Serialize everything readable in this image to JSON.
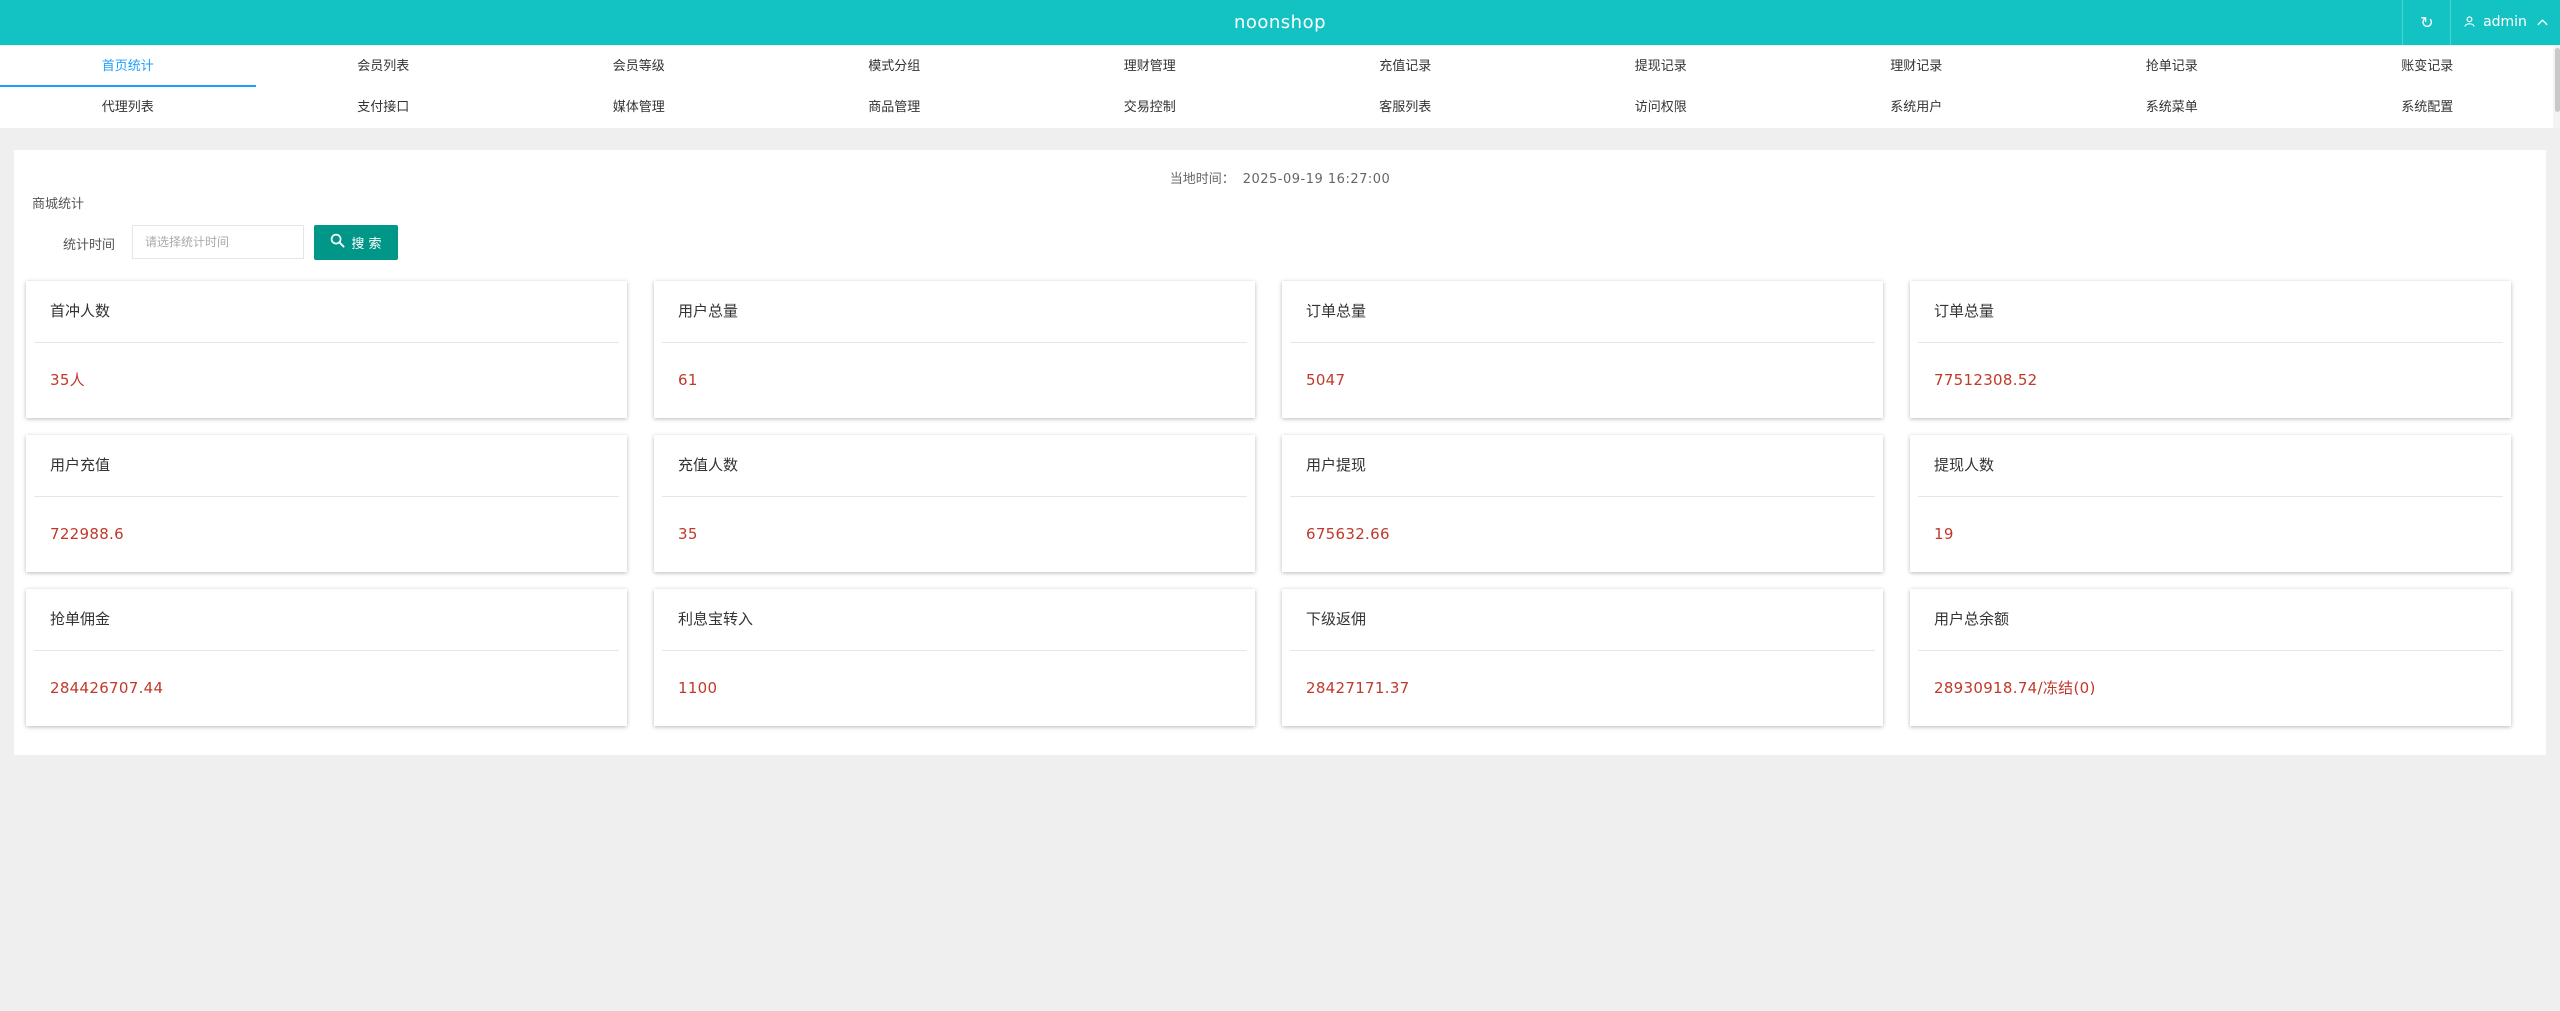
{
  "header": {
    "title": "noonshop",
    "refresh_icon": "refresh-icon",
    "user_icon": "user-icon",
    "user_name": "admin",
    "caret_icon": "chevron-up-icon",
    "bg_color": "#13c2c2"
  },
  "nav": {
    "row1": [
      "首页统计",
      "会员列表",
      "会员等级",
      "模式分组",
      "理财管理",
      "充值记录",
      "提现记录",
      "理财记录",
      "抢单记录",
      "账变记录"
    ],
    "row2": [
      "代理列表",
      "支付接口",
      "媒体管理",
      "商品管理",
      "交易控制",
      "客服列表",
      "访问权限",
      "系统用户",
      "系统菜单",
      "系统配置"
    ],
    "active": "首页统计",
    "active_color": "#1e9fff"
  },
  "panel": {
    "local_time_label": "当地时间：",
    "local_time_value": "2025-09-19 16:27:00",
    "section_label": "商城统计",
    "filter_label": "统计时间",
    "date_placeholder": "请选择统计时间",
    "date_value": "",
    "search_label": "搜 索",
    "search_icon": "search-icon",
    "button_color": "#009688"
  },
  "cards": [
    {
      "title": "首冲人数",
      "value": "35人"
    },
    {
      "title": "用户总量",
      "value": "61"
    },
    {
      "title": "订单总量",
      "value": "5047"
    },
    {
      "title": "订单总量",
      "value": "77512308.52"
    },
    {
      "title": "用户充值",
      "value": "722988.6"
    },
    {
      "title": "充值人数",
      "value": "35"
    },
    {
      "title": "用户提现",
      "value": "675632.66"
    },
    {
      "title": "提现人数",
      "value": "19"
    },
    {
      "title": "抢单佣金",
      "value": "284426707.44"
    },
    {
      "title": "利息宝转入",
      "value": "1100"
    },
    {
      "title": "下级返佣",
      "value": "28427171.37"
    },
    {
      "title": "用户总余额",
      "value": "28930918.74/冻结(0)"
    }
  ],
  "value_color": "#c0392b"
}
